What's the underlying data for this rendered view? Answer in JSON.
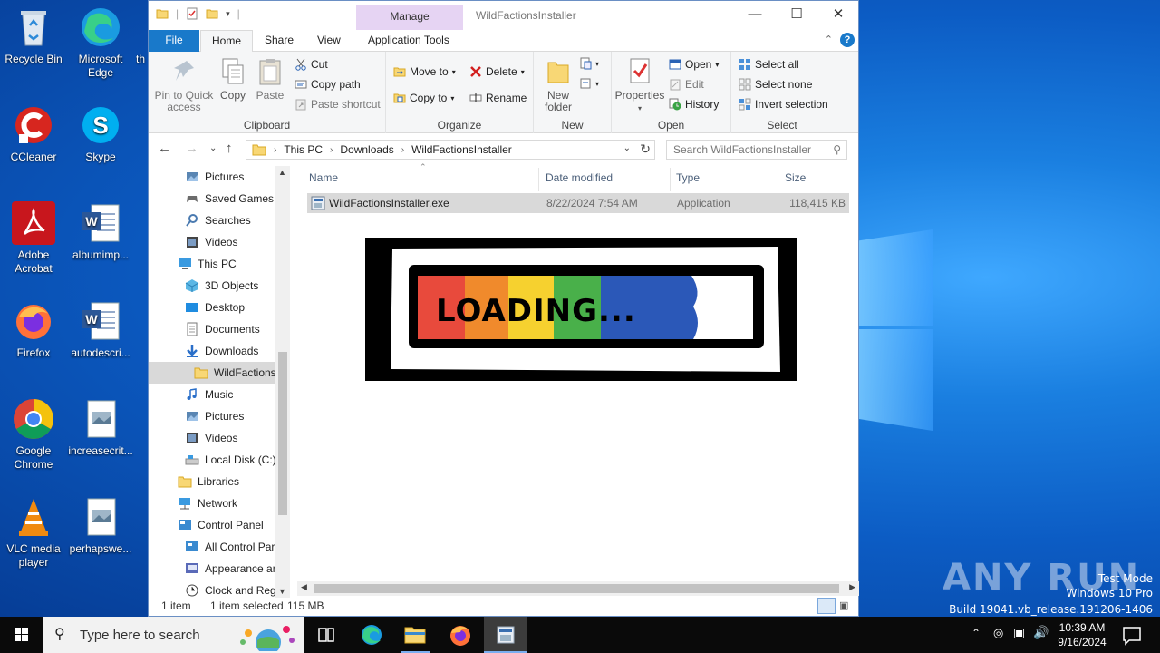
{
  "desktop": {
    "icons": [
      {
        "label": "Recycle Bin"
      },
      {
        "label": "Microsoft Edge"
      },
      {
        "label": "CCleaner"
      },
      {
        "label": "Skype"
      },
      {
        "label": "Adobe Acrobat"
      },
      {
        "label": "albumimp..."
      },
      {
        "label": "Firefox"
      },
      {
        "label": "autodescri..."
      },
      {
        "label": "Google Chrome"
      },
      {
        "label": "increasecrit..."
      },
      {
        "label": "VLC media player"
      },
      {
        "label": "perhapswe..."
      }
    ],
    "partial_label": "th",
    "watermark": {
      "brand": "ANY RUN",
      "test_mode": "Test Mode",
      "edition": "Windows 10 Pro",
      "build": "Build 19041.vb_release.191206-1406"
    }
  },
  "window": {
    "title": "WildFactionsInstaller",
    "manage_tab": "Manage",
    "tabs": [
      "File",
      "Home",
      "Share",
      "View",
      "Application Tools"
    ],
    "help_label": "?",
    "ribbon": {
      "clipboard": {
        "label": "Clipboard",
        "pin": "Pin to Quick access",
        "copy": "Copy",
        "paste": "Paste",
        "cut": "Cut",
        "copy_path": "Copy path",
        "paste_shortcut": "Paste shortcut"
      },
      "organize": {
        "label": "Organize",
        "move_to": "Move to",
        "copy_to": "Copy to",
        "delete": "Delete",
        "rename": "Rename"
      },
      "new": {
        "label": "New",
        "new_folder": "New folder"
      },
      "open": {
        "label": "Open",
        "properties": "Properties",
        "open": "Open",
        "edit": "Edit",
        "history": "History"
      },
      "select": {
        "label": "Select",
        "select_all": "Select all",
        "select_none": "Select none",
        "invert": "Invert selection"
      }
    },
    "address": {
      "segments": [
        "This PC",
        "Downloads",
        "WildFactionsInstaller"
      ],
      "search_placeholder": "Search WildFactionsInstaller"
    },
    "nav": [
      {
        "label": "Pictures",
        "icon": "pictures-icon"
      },
      {
        "label": "Saved Games",
        "icon": "saved-games-icon"
      },
      {
        "label": "Searches",
        "icon": "searches-icon"
      },
      {
        "label": "Videos",
        "icon": "videos-icon"
      },
      {
        "label": "This PC",
        "icon": "this-pc-icon"
      },
      {
        "label": "3D Objects",
        "icon": "3d-objects-icon"
      },
      {
        "label": "Desktop",
        "icon": "desktop-icon"
      },
      {
        "label": "Documents",
        "icon": "documents-icon"
      },
      {
        "label": "Downloads",
        "icon": "downloads-icon"
      },
      {
        "label": "WildFactionsI",
        "icon": "folder-icon"
      },
      {
        "label": "Music",
        "icon": "music-icon"
      },
      {
        "label": "Pictures",
        "icon": "pictures-icon"
      },
      {
        "label": "Videos",
        "icon": "videos-icon"
      },
      {
        "label": "Local Disk (C:)",
        "icon": "disk-icon"
      },
      {
        "label": "Libraries",
        "icon": "libraries-icon"
      },
      {
        "label": "Network",
        "icon": "network-icon"
      },
      {
        "label": "Control Panel",
        "icon": "control-panel-icon"
      },
      {
        "label": "All Control Par",
        "icon": "control-panel-icon"
      },
      {
        "label": "Appearance an",
        "icon": "appearance-icon"
      },
      {
        "label": "Clock and Regi",
        "icon": "clock-icon"
      }
    ],
    "columns": [
      "Name",
      "Date modified",
      "Type",
      "Size"
    ],
    "files": [
      {
        "name": "WildFactionsInstaller.exe",
        "date": "8/22/2024 7:54 AM",
        "type": "Application",
        "size": "118,415 KB"
      }
    ],
    "loading_image_text": "LOADING...",
    "status": {
      "count": "1 item",
      "selected": "1 item selected",
      "size": "115 MB"
    }
  },
  "taskbar": {
    "search_placeholder": "Type here to search",
    "time": "10:39 AM",
    "date": "9/16/2024"
  },
  "colors": {
    "accent": "#1979ca",
    "manage_tab": "#e6d4f3",
    "selection": "#d9d9d9"
  }
}
